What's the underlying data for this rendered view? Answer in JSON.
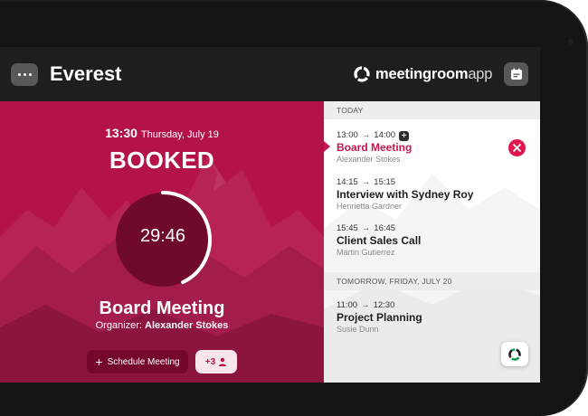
{
  "header": {
    "room_name": "Everest",
    "brand_bold": "meetingroom",
    "brand_light": "app"
  },
  "current": {
    "time": "13:30",
    "date": "Thursday, July 19",
    "status": "BOOKED",
    "timer": "29:46",
    "timer_progress": 0.43,
    "meeting_title": "Board Meeting",
    "organizer_label": "Organizer:",
    "organizer_name": "Alexander Stokes",
    "schedule_label": "Schedule Meeting",
    "attendees_count": "+3"
  },
  "agenda": {
    "days": [
      {
        "label": "TODAY",
        "events": [
          {
            "start": "13:00",
            "arrow": "→",
            "end": "14:00",
            "title": "Board Meeting",
            "organizer": "Alexander Stokes",
            "active": true,
            "badge": "+"
          },
          {
            "start": "14:15",
            "arrow": "→",
            "end": "15:15",
            "title": "Interview with Sydney Roy",
            "organizer": "Henrietta Gardner"
          },
          {
            "start": "15:45",
            "arrow": "→",
            "end": "16:45",
            "title": "Client Sales Call",
            "organizer": "Martin Gutierrez"
          }
        ]
      },
      {
        "label": "TOMORROW, FRIDAY, JULY 20",
        "events": [
          {
            "start": "11:00",
            "arrow": "→",
            "end": "12:30",
            "title": "Project Planning",
            "organizer": "Susie Dunn"
          }
        ]
      }
    ]
  },
  "colors": {
    "booked": "#b31349",
    "accent": "#c8184f",
    "header": "#1e1e20"
  },
  "icons": [
    "more-icon",
    "calendar-icon",
    "meetingroomapp-logo-icon",
    "plus-icon",
    "person-icon",
    "close-icon",
    "app-logo-icon"
  ]
}
